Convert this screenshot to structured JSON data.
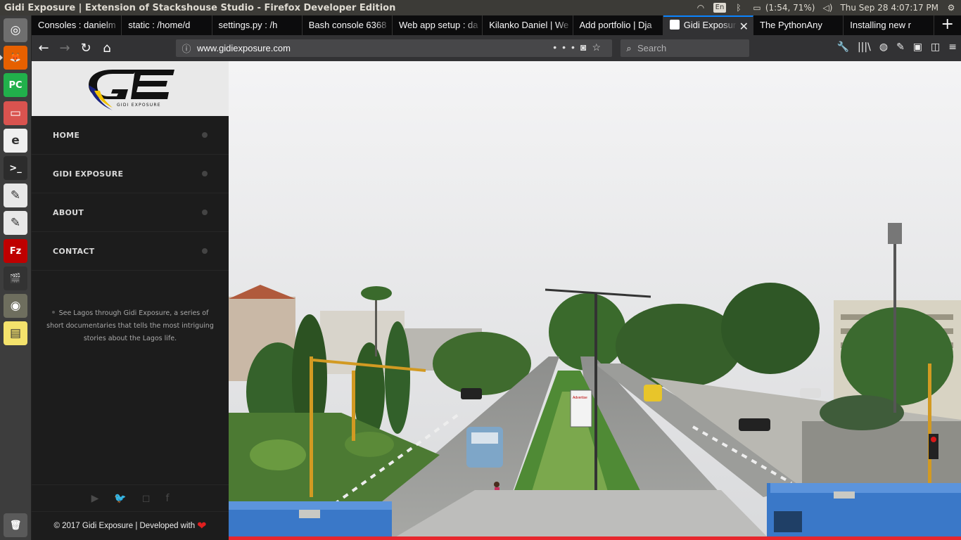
{
  "os": {
    "window_title": "Gidi Exposure | Extension of Stackshouse Studio - Firefox Developer Edition",
    "keyboard_layout": "En",
    "battery": "(1:54, 71%)",
    "clock": "Thu Sep 28  4:07:17 PM",
    "icons": [
      "wifi-icon",
      "keyboard-icon",
      "bluetooth-icon",
      "battery-icon",
      "volume-icon",
      "settings-icon"
    ]
  },
  "launcher": {
    "items": [
      {
        "name": "dash-icon",
        "glyph": "◎",
        "color": "#6f6f6f"
      },
      {
        "name": "firefox-icon",
        "glyph": "🦊",
        "color": "#e66000"
      },
      {
        "name": "pycharm-icon",
        "glyph": "PC",
        "color": "#21b04b"
      },
      {
        "name": "files-icon",
        "glyph": "▭",
        "color": "#d9534f"
      },
      {
        "name": "text-editor-icon",
        "glyph": "e",
        "color": "#f0f0f0"
      },
      {
        "name": "terminal-icon",
        "glyph": ">_",
        "color": "#2c2c2c"
      },
      {
        "name": "gedit-icon",
        "glyph": "✎",
        "color": "#e8e8e8"
      },
      {
        "name": "gedit2-icon",
        "glyph": "✎",
        "color": "#e8e8e8"
      },
      {
        "name": "filezilla-icon",
        "glyph": "Fz",
        "color": "#bf0000"
      },
      {
        "name": "video-editor-icon",
        "glyph": "🎬",
        "color": "#333333"
      },
      {
        "name": "gimp-icon",
        "glyph": "◉",
        "color": "#6e6e5e"
      },
      {
        "name": "sticky-notes-icon",
        "glyph": "▤",
        "color": "#f4e26c"
      },
      {
        "name": "trash-icon",
        "glyph": "🗑",
        "color": "#5a5a5a"
      }
    ]
  },
  "browser": {
    "tabs": [
      {
        "label": "Consoles : danielm"
      },
      {
        "label": "static : /home/d"
      },
      {
        "label": "settings.py : /h"
      },
      {
        "label": "Bash console 6368"
      },
      {
        "label": "Web app setup : da"
      },
      {
        "label": "Kilanko Daniel | We"
      },
      {
        "label": "Add portfolio | Dja"
      },
      {
        "label": "Gidi Exposur",
        "selected": true
      },
      {
        "label": "The PythonAny"
      },
      {
        "label": "Installing new r"
      }
    ],
    "new_tab": "+",
    "url": "www.gidiexposure.com",
    "search_placeholder": "Search",
    "page_actions": "•••",
    "close_tab": "✕"
  },
  "site": {
    "logo_text": "GIDI EXPOSURE",
    "menu": [
      {
        "label": "HOME"
      },
      {
        "label": "GIDI EXPOSURE"
      },
      {
        "label": "ABOUT"
      },
      {
        "label": "CONTACT"
      }
    ],
    "tagline": "See Lagos through Gidi Exposure, a series of short documentaries that tells the most intriguing stories about the Lagos life.",
    "social": [
      "youtube-icon",
      "twitter-icon",
      "instagram-icon",
      "facebook-icon"
    ],
    "footer": "© 2017 Gidi Exposure | Developed with",
    "accent_color": "#e7272d"
  }
}
